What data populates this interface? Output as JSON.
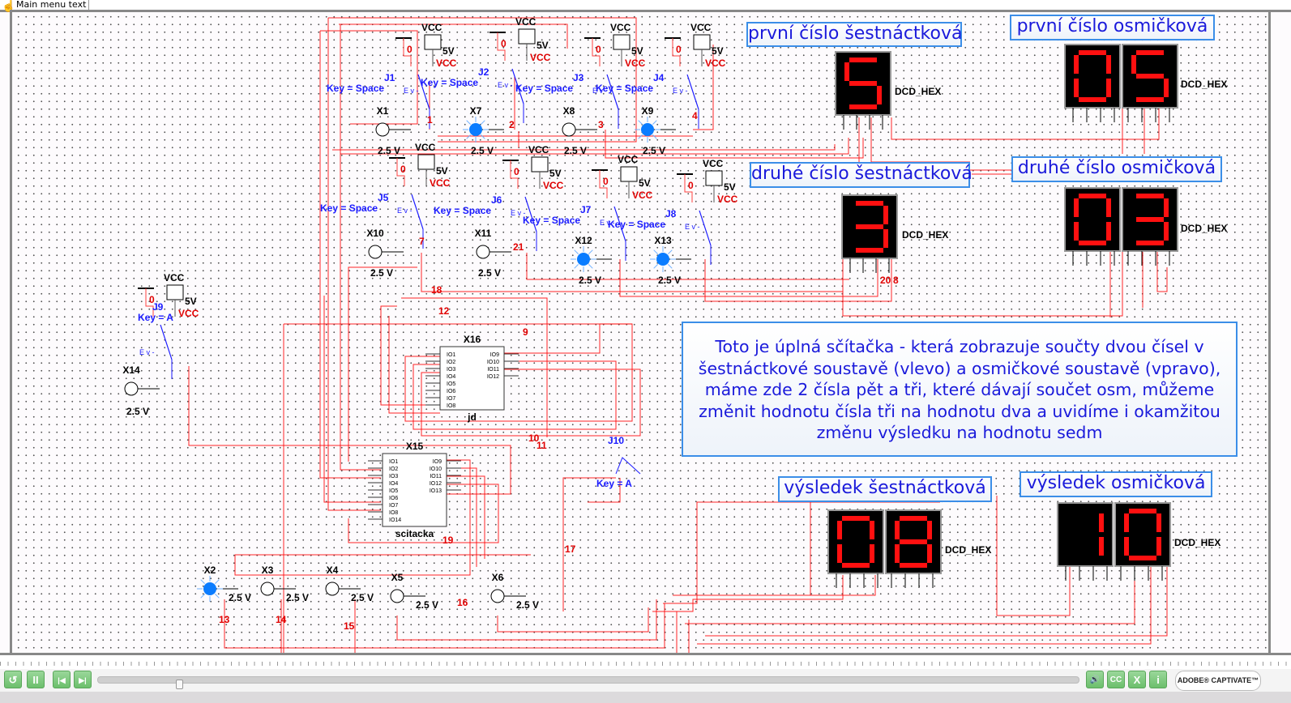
{
  "player": {
    "menu_text": "Main menu text",
    "logo_text": "ADOBE® CAPTIVATE™",
    "buttons": {
      "rewind": "↺",
      "pause": "II",
      "back": "|◀",
      "forward": "▶|",
      "audio": "🔊",
      "cc": "CC",
      "close": "X",
      "info": "i"
    },
    "progress_percent": 8,
    "accent_color": "#6cbf6c"
  },
  "labels": {
    "hex_first": "první číslo šestnáctková",
    "oct_first": "první číslo osmičková",
    "hex_second": "druhé číslo šestnáctková",
    "oct_second": "druhé číslo osmičková",
    "hex_result": "výsledek šestnáctková",
    "oct_result": "výsledek osmičková",
    "description": "Toto je úplná sčítačka - která zobrazuje součty dvou čísel v šestnáctkové soustavě (vlevo) a osmičkové soustavě (vpravo), máme zde 2 čísla pět a tři, které dávají součet osm, můžeme změnit hodnotu čísla tři na hodnotu dva a uvidíme i okamžitou změnu výsledku na hodnotu sedm"
  },
  "switches": [
    {
      "id": "J1",
      "key": "Key = Space",
      "vcc": "VCC",
      "volt": "5V",
      "gnd": "0",
      "vcc_net": "VCC"
    },
    {
      "id": "J2",
      "key": "Key = Space",
      "vcc": "VCC",
      "volt": "5V",
      "gnd": "0",
      "vcc_net": "VCC"
    },
    {
      "id": "J3",
      "key": "Key = Space",
      "vcc": "VCC",
      "volt": "5V",
      "gnd": "0",
      "vcc_net": "VCC"
    },
    {
      "id": "J4",
      "key": "Key = Space",
      "vcc": "VCC",
      "volt": "5V",
      "gnd": "0",
      "vcc_net": "VCC"
    },
    {
      "id": "J5",
      "key": "Key = Space",
      "vcc": "VCC",
      "volt": "5V",
      "gnd": "0",
      "vcc_net": "VCC"
    },
    {
      "id": "J6",
      "key": "Key = Space",
      "vcc": "VCC",
      "volt": "5V",
      "gnd": "0",
      "vcc_net": "VCC"
    },
    {
      "id": "J7",
      "key": "Key = Space",
      "vcc": "VCC",
      "volt": "5V",
      "gnd": "0",
      "vcc_net": "VCC"
    },
    {
      "id": "J8",
      "key": "Key = Space",
      "vcc": "VCC",
      "volt": "5V",
      "gnd": "0",
      "vcc_net": "VCC"
    },
    {
      "id": "J9",
      "key": "Key = A",
      "vcc": "VCC",
      "volt": "5V",
      "gnd": "0",
      "vcc_net": "VCC"
    }
  ],
  "switch_j10": {
    "id": "J10",
    "key": "Key = A"
  },
  "switch_mark": "E v -",
  "probes": [
    {
      "id": "X1",
      "voltage": "2.5 V",
      "lit": false
    },
    {
      "id": "X7",
      "voltage": "2.5 V",
      "lit": true
    },
    {
      "id": "X8",
      "voltage": "2.5 V",
      "lit": false
    },
    {
      "id": "X9",
      "voltage": "2.5 V",
      "lit": true
    },
    {
      "id": "X10",
      "voltage": "2.5 V",
      "lit": false
    },
    {
      "id": "X11",
      "voltage": "2.5 V",
      "lit": false
    },
    {
      "id": "X12",
      "voltage": "2.5 V",
      "lit": true
    },
    {
      "id": "X13",
      "voltage": "2.5 V",
      "lit": true
    },
    {
      "id": "X14",
      "voltage": "2.5 V",
      "lit": false
    },
    {
      "id": "X2",
      "voltage": "2.5 V",
      "lit": true
    },
    {
      "id": "X3",
      "voltage": "2.5 V",
      "lit": false
    },
    {
      "id": "X4",
      "voltage": "2.5 V",
      "lit": false
    },
    {
      "id": "X5",
      "voltage": "2.5 V",
      "lit": false
    },
    {
      "id": "X6",
      "voltage": "2.5 V",
      "lit": false
    }
  ],
  "nets": [
    "1",
    "2",
    "3",
    "4",
    "7",
    "21",
    "18",
    "12",
    "9",
    "10",
    "11",
    "19",
    "17",
    "16",
    "13",
    "14",
    "15",
    "20",
    "8"
  ],
  "chips": [
    {
      "id": "X16",
      "name": "jd",
      "left_pins": [
        "IO1",
        "IO2",
        "IO3",
        "IO4",
        "IO5",
        "IO6",
        "IO7",
        "IO8"
      ],
      "right_pins": [
        "IO9",
        "IO10",
        "IO11",
        "IO12"
      ]
    },
    {
      "id": "X15",
      "name": "scitacka",
      "left_pins": [
        "IO1",
        "IO2",
        "IO3",
        "IO4",
        "IO5",
        "IO6",
        "IO7",
        "IO8",
        "IO14"
      ],
      "right_pins": [
        "IO9",
        "IO10",
        "IO11",
        "IO12",
        "IO13"
      ]
    }
  ],
  "displays": [
    {
      "name": "hex-first",
      "digits": [
        "5"
      ],
      "type": "DCD_HEX"
    },
    {
      "name": "oct-first",
      "digits": [
        "0",
        "5"
      ],
      "type": "DCD_HEX"
    },
    {
      "name": "hex-second",
      "digits": [
        "3"
      ],
      "type": "DCD_HEX"
    },
    {
      "name": "oct-second",
      "digits": [
        "0",
        "3"
      ],
      "type": "DCD_HEX"
    },
    {
      "name": "hex-result",
      "digits": [
        "0",
        "8"
      ],
      "type": "DCD_HEX"
    },
    {
      "name": "oct-result",
      "digits": [
        "1",
        "0"
      ],
      "type": "DCD_HEX"
    }
  ],
  "colors": {
    "wire": "#ff0000",
    "switch": "#1a1aff",
    "probe_lit": "#0a7cff",
    "segment": "#ff1010",
    "label_border": "#3b8ee8"
  }
}
